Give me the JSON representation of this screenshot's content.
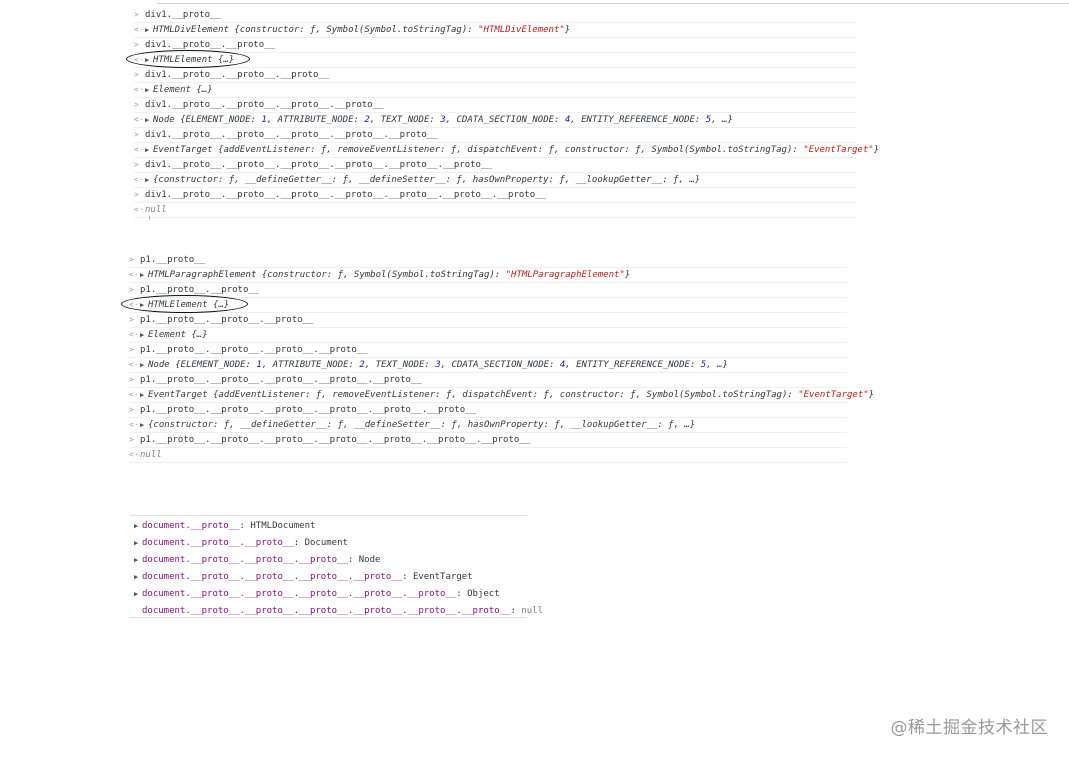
{
  "block1": {
    "rows": [
      {
        "kind": "input",
        "text": "div1.__proto__"
      },
      {
        "kind": "output",
        "expand": true,
        "name": "HTMLDivElement",
        "rest": " {constructor: ƒ, Symbol(Symbol.toStringTag): ",
        "str": "\"HTMLDivElement\"",
        "end": "}"
      },
      {
        "kind": "input",
        "text": "div1.__proto__.__proto__"
      },
      {
        "kind": "output",
        "expand": true,
        "name": "HTMLElement",
        "rest": " {…}",
        "str": "",
        "end": ""
      },
      {
        "kind": "input",
        "text": "div1.__proto__.__proto__.__proto__"
      },
      {
        "kind": "output",
        "expand": true,
        "name": "Element",
        "rest": " {…}",
        "str": "",
        "end": ""
      },
      {
        "kind": "input",
        "text": "div1.__proto__.__proto__.__proto__.__proto__"
      },
      {
        "kind": "output",
        "expand": true,
        "name": "Node",
        "rest": " {ELEMENT_NODE: 1, ATTRIBUTE_NODE: 2, TEXT_NODE: 3, CDATA_SECTION_NODE: 4, ENTITY_REFERENCE_NODE: 5, …}",
        "str": "",
        "end": ""
      },
      {
        "kind": "input",
        "text": "div1.__proto__.__proto__.__proto__.__proto__.__proto__"
      },
      {
        "kind": "output",
        "expand": true,
        "name": "EventTarget",
        "rest": " {addEventListener: ƒ, removeEventListener: ƒ, dispatchEvent: ƒ, constructor: ƒ, Symbol(Symbol.toStringTag): ",
        "str": "\"EventTarget\"",
        "end": "}"
      },
      {
        "kind": "input",
        "text": "div1.__proto__.__proto__.__proto__.__proto__.__proto__.__proto__"
      },
      {
        "kind": "output",
        "expand": true,
        "name": "",
        "rest": "{constructor: ƒ, __defineGetter__: ƒ, __defineSetter__: ƒ, hasOwnProperty: ƒ, __lookupGetter__: ƒ, …}",
        "str": "",
        "end": ""
      },
      {
        "kind": "input",
        "text": "div1.__proto__.__proto__.__proto__.__proto__.__proto__.__proto__.__proto__"
      },
      {
        "kind": "output",
        "expand": false,
        "name": "",
        "rest": "null",
        "str": "",
        "end": ""
      }
    ]
  },
  "block2": {
    "rows": [
      {
        "kind": "input",
        "text": "p1.__proto__"
      },
      {
        "kind": "output",
        "expand": true,
        "name": "HTMLParagraphElement",
        "rest": " {constructor: ƒ, Symbol(Symbol.toStringTag): ",
        "str": "\"HTMLParagraphElement\"",
        "end": "}"
      },
      {
        "kind": "input",
        "text": "p1.__proto__.__proto__"
      },
      {
        "kind": "output",
        "expand": true,
        "name": "HTMLElement",
        "rest": " {…}",
        "str": "",
        "end": ""
      },
      {
        "kind": "input",
        "text": "p1.__proto__.__proto__.__proto__"
      },
      {
        "kind": "output",
        "expand": true,
        "name": "Element",
        "rest": " {…}",
        "str": "",
        "end": ""
      },
      {
        "kind": "input",
        "text": "p1.__proto__.__proto__.__proto__.__proto__"
      },
      {
        "kind": "output",
        "expand": true,
        "name": "Node",
        "rest": " {ELEMENT_NODE: 1, ATTRIBUTE_NODE: 2, TEXT_NODE: 3, CDATA_SECTION_NODE: 4, ENTITY_REFERENCE_NODE: 5, …}",
        "str": "",
        "end": ""
      },
      {
        "kind": "input",
        "text": "p1.__proto__.__proto__.__proto__.__proto__.__proto__"
      },
      {
        "kind": "output",
        "expand": true,
        "name": "EventTarget",
        "rest": " {addEventListener: ƒ, removeEventListener: ƒ, dispatchEvent: ƒ, constructor: ƒ, Symbol(Symbol.toStringTag): ",
        "str": "\"EventTarget\"",
        "end": "}"
      },
      {
        "kind": "input",
        "text": "p1.__proto__.__proto__.__proto__.__proto__.__proto__.__proto__"
      },
      {
        "kind": "output",
        "expand": true,
        "name": "",
        "rest": "{constructor: ƒ, __defineGetter__: ƒ, __defineSetter__: ƒ, hasOwnProperty: ƒ, __lookupGetter__: ƒ, …}",
        "str": "",
        "end": ""
      },
      {
        "kind": "input",
        "text": "p1.__proto__.__proto__.__proto__.__proto__.__proto__.__proto__.__proto__"
      },
      {
        "kind": "output",
        "expand": false,
        "name": "",
        "rest": "null",
        "str": "",
        "end": ""
      }
    ]
  },
  "document_panel": {
    "rows": [
      {
        "expand": true,
        "key": "document.__proto__",
        "value": "HTMLDocument"
      },
      {
        "expand": true,
        "key": "document.__proto__.__proto__",
        "value": "Document"
      },
      {
        "expand": true,
        "key": "document.__proto__.__proto__.__proto__",
        "value": "Node"
      },
      {
        "expand": true,
        "key": "document.__proto__.__proto__.__proto__.__proto__",
        "value": "EventTarget"
      },
      {
        "expand": true,
        "key": "document.__proto__.__proto__.__proto__.__proto__.__proto__",
        "value": "Object"
      },
      {
        "expand": false,
        "key": "document.__proto__.__proto__.__proto__.__proto__.__proto__.__proto__",
        "value": "null"
      }
    ]
  },
  "watermark": "@稀土掘金技术社区",
  "colors": {
    "string": "#c41a16",
    "number": "#1a1aa6",
    "key": "#881280",
    "text": "#303942"
  },
  "icons": {
    "input_prompt": "chevron-right-icon",
    "output_prompt": "return-arrow-icon",
    "expand": "triangle-right-icon"
  }
}
